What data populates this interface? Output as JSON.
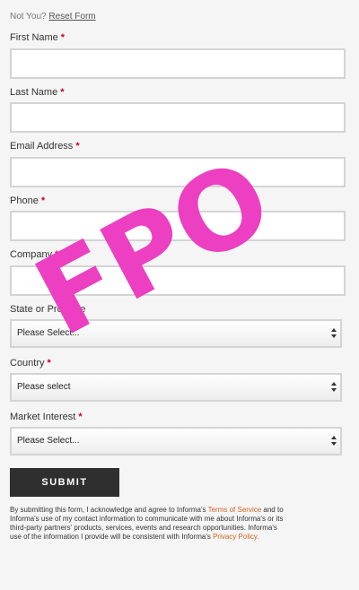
{
  "header": {
    "not_you": "Not You?",
    "reset_form": "Reset Form"
  },
  "fields": {
    "first_name": {
      "label": "First Name",
      "value": ""
    },
    "last_name": {
      "label": "Last Name",
      "value": ""
    },
    "email": {
      "label": "Email Address",
      "value": ""
    },
    "phone": {
      "label": "Phone",
      "value": ""
    },
    "company": {
      "label": "Company",
      "value": ""
    },
    "state": {
      "label": "State or Province",
      "selected": "Please Select..."
    },
    "country": {
      "label": "Country",
      "selected": "Please select"
    },
    "market_interest": {
      "label": "Market Interest",
      "selected": "Please Select..."
    }
  },
  "required_marker": "*",
  "submit_label": "SUBMIT",
  "disclaimer": {
    "part1": "By submitting this form, I acknowledge and agree to Informa's ",
    "terms_link": "Terms of Service",
    "part2": " and to Informa's use of my contact information to communicate with me about Informa's or its third-party partners' products, services, events and research opportunities. Informa's use of the information I provide will be consistent with Informa's ",
    "privacy_link": "Privacy Policy."
  },
  "watermark": {
    "text": "FPO",
    "color": "#ec3fc1"
  },
  "colors": {
    "background": "#f5f5f5",
    "required": "#d0021b",
    "link": "#d4621c",
    "button": "#2f2f2f"
  }
}
